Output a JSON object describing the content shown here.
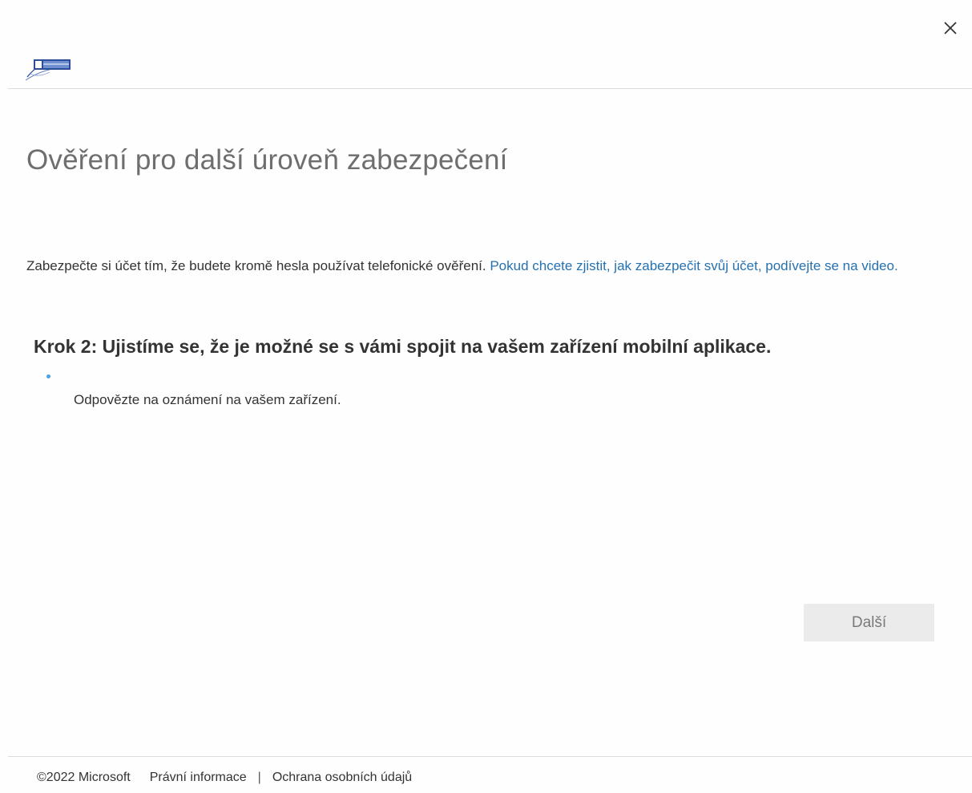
{
  "header": {
    "close_icon": "close-icon",
    "logo_icon": "organization-logo"
  },
  "main": {
    "title": "Ověření pro další úroveň zabezpečení",
    "intro_text": "Zabezpečte si účet tím, že budete kromě hesla používat telefonické ověření. ",
    "intro_link": "Pokud chcete zjistit, jak zabezpečit svůj účet, podívejte se na video.",
    "step_title": "Krok 2: Ujistíme se, že je možné se s vámi spojit na vašem zařízení mobilní aplikace.",
    "instruction": "Odpovězte na oznámení na vašem zařízení.",
    "next_button_label": "Další"
  },
  "footer": {
    "copyright": "©2022 Microsoft",
    "legal_link": "Právní informace",
    "separator": "|",
    "privacy_link": "Ochrana osobních údajů"
  },
  "colors": {
    "link": "#2671b0",
    "title": "#6e6e6e",
    "button_bg": "#ebebeb",
    "status_dot": "#4aa3df"
  }
}
